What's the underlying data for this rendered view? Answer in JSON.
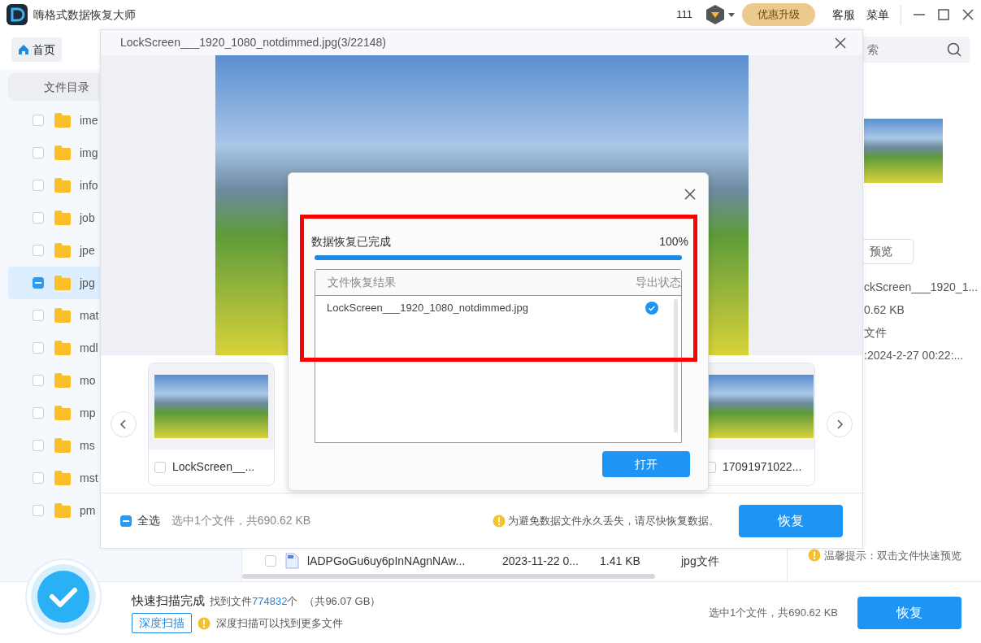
{
  "app": {
    "title": "嗨格式数据恢复大师",
    "count": "111",
    "upgrade": "优惠升级",
    "menu_items": [
      "客服",
      "菜单"
    ]
  },
  "nav": {
    "tab": "首页",
    "search_placeholder": "索"
  },
  "sidebar": {
    "header": "文件目录",
    "folders": [
      {
        "name": "ime",
        "selected": false,
        "partial": false
      },
      {
        "name": "img",
        "selected": false,
        "partial": false
      },
      {
        "name": "info",
        "selected": false,
        "partial": false
      },
      {
        "name": "job",
        "selected": false,
        "partial": false
      },
      {
        "name": "jpe",
        "selected": false,
        "partial": false
      },
      {
        "name": "jpg",
        "selected": true,
        "partial": true
      },
      {
        "name": "mat",
        "selected": false,
        "partial": false
      },
      {
        "name": "mdl",
        "selected": false,
        "partial": false
      },
      {
        "name": "mo",
        "selected": false,
        "partial": false
      },
      {
        "name": "mp",
        "selected": false,
        "partial": false
      },
      {
        "name": "ms",
        "selected": false,
        "partial": false
      },
      {
        "name": "mst",
        "selected": false,
        "partial": false
      },
      {
        "name": "pm",
        "selected": false,
        "partial": false
      }
    ]
  },
  "details": {
    "preview_button": "预览",
    "lines": [
      "ckScreen___1920_1...",
      "0.62 KB",
      "文件",
      ":2024-2-27 00:22:..."
    ],
    "tip": "温馨提示：双击文件快速预览"
  },
  "file_row": {
    "checked": false,
    "name": "lADPGoGu6uy6pInNAgnNAw...",
    "date": "2023-11-22 0...",
    "size": "1.41 KB",
    "type": "jpg文件"
  },
  "status": {
    "title": "快速扫描完成",
    "found_label": "找到文件",
    "found_count": "774832",
    "found_unit": "个",
    "total": "（共96.07 GB）",
    "deep_scan": "深度扫描",
    "deep_tip": "深度扫描可以找到更多文件",
    "summary": "选中1个文件，共690.62 KB",
    "recover": "恢复"
  },
  "preview": {
    "title": "LockScreen___1920_1080_notdimmed.jpg(3/22148)",
    "thumbnails": [
      {
        "label": "LockScreen__...",
        "checked": false
      },
      {
        "label": "17091971022...",
        "checked": false
      }
    ],
    "footer": {
      "select_all": "全选",
      "select_all_partial": true,
      "summary": "选中1个文件，共690.62 KB",
      "warning": "为避免数据文件永久丢失，请尽快恢复数据。",
      "recover": "恢复"
    }
  },
  "dialog": {
    "title": "数据恢复已完成",
    "percent": "100%",
    "level": 1,
    "columns": [
      "文件恢复结果",
      "导出状态"
    ],
    "rows": [
      {
        "name": "LockScreen___1920_1080_notdimmed.jpg",
        "exported": true
      }
    ],
    "open": "打开"
  }
}
